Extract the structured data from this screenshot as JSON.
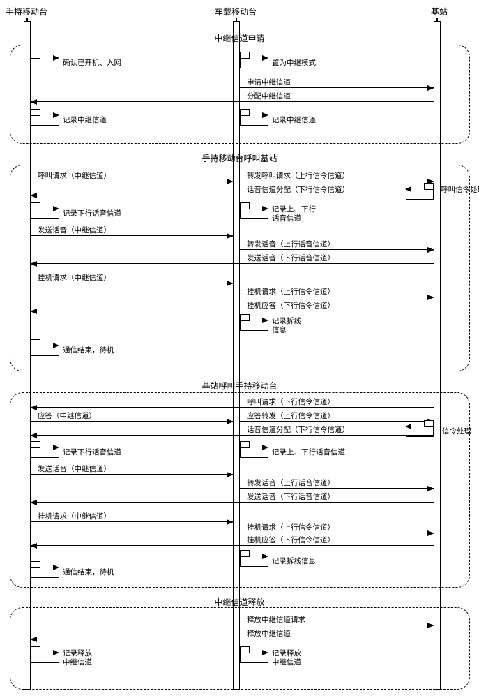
{
  "actors": {
    "handset": "手持移动台",
    "vehicle": "车载移动台",
    "base": "基站"
  },
  "sections": {
    "s1_title": "中继信道申请",
    "s2_title": "手持移动台呼叫基站",
    "s3_title": "基站呼叫手持移动台",
    "s4_title": "中继信道释放"
  },
  "s1": {
    "self_confirm": "确认已开机、入网",
    "self_relay_mode": "置为中继模式",
    "req_relay": "申请中继信道",
    "alloc_relay": "分配中继信道",
    "rec_relay_h": "记录中继信道",
    "rec_relay_v": "记录中继信道"
  },
  "s2": {
    "call_req": "呼叫请求（中继信道）",
    "fwd_call_req": "转发呼叫请求（上行信令信道）",
    "voice_alloc": "话音信道分配（下行信令信道）",
    "self_sig_proc": "呼叫信令处理",
    "rec_down_voice": "记录下行话音信道",
    "rec_updown_voice": "记录上、下行\n话音信道",
    "send_voice": "发送话音（中继信道）",
    "fwd_voice": "转发话音（上行话音信道）",
    "send_voice_down": "发送话音（下行话音信道）",
    "hangup_req": "挂机请求（中继信道）",
    "hangup_fwd": "挂机请求（上行信令信道）",
    "hangup_ack": "挂机应答（下行信令信道）",
    "rec_teardown": "记录拆线\n信息",
    "comm_end": "通信结束，待机"
  },
  "s3": {
    "call_req": "呼叫请求（下行信令信道）",
    "answer": "应答（中继信道）",
    "answer_fwd": "应答转发（上行信令信道）",
    "voice_alloc": "话音信道分配（下行信令信道）",
    "sig_proc": "信令处理",
    "rec_down_voice": "记录下行话音信道",
    "rec_updown_voice": "记录上、下行话音信道",
    "send_voice": "发送话音（中继信道）",
    "fwd_voice": "转发话音（上行话音信道）",
    "send_voice_down": "发送话音（下行话音信道）",
    "hangup_req": "挂机请求（中继信道）",
    "hangup_fwd": "挂机请求（上行信令信道）",
    "hangup_ack": "挂机应答（下行信令信道）",
    "rec_teardown": "记录拆线信息",
    "comm_end": "通信结束，待机"
  },
  "s4": {
    "release_req": "释放中继信道请求",
    "release": "释放中继信道",
    "rec_release_h": "记录释放\n中继信道",
    "rec_release_v": "记录释放\n中继信道"
  }
}
